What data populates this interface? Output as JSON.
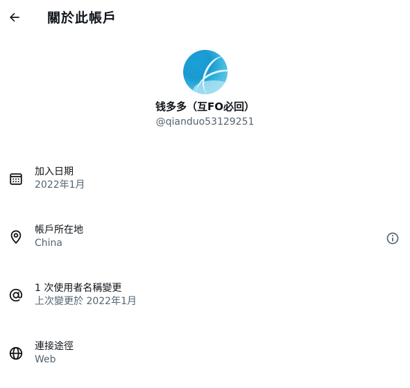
{
  "header": {
    "back_icon": "arrow-left-icon",
    "title": "關於此帳戶"
  },
  "profile": {
    "display_name": "钱多多（互FO必回）",
    "handle": "@qianduo53129251"
  },
  "rows": [
    {
      "icon": "calendar-icon",
      "label": "加入日期",
      "value": "2022年1月"
    },
    {
      "icon": "location-pin-icon",
      "label": "帳戶所在地",
      "value": "China",
      "trailing_icon": "info-icon"
    },
    {
      "icon": "at-sign-icon",
      "label": "1 次使用者名稱變更",
      "value": "上次變更於 2022年1月"
    },
    {
      "icon": "globe-icon",
      "label": "連接途徑",
      "value": "Web"
    }
  ]
}
